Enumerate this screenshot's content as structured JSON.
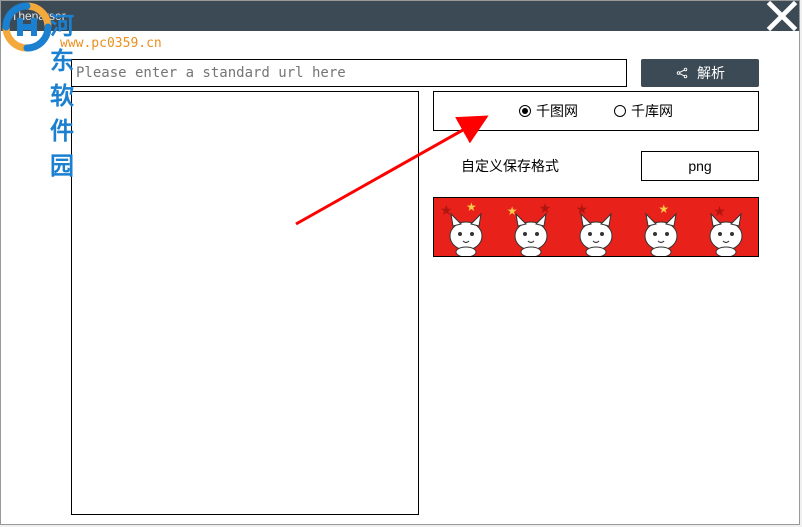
{
  "window": {
    "title": "Theparser"
  },
  "toolbar": {
    "url_placeholder": "Please enter a standard url here",
    "parse_label": "解析"
  },
  "options": {
    "source": [
      {
        "label": "千图网",
        "checked": true
      },
      {
        "label": "千库网",
        "checked": false
      }
    ],
    "format_label": "自定义保存格式",
    "format_value": "png"
  },
  "watermark": {
    "site_name": "河东软件园",
    "site_url": "www.pc0359.cn"
  }
}
